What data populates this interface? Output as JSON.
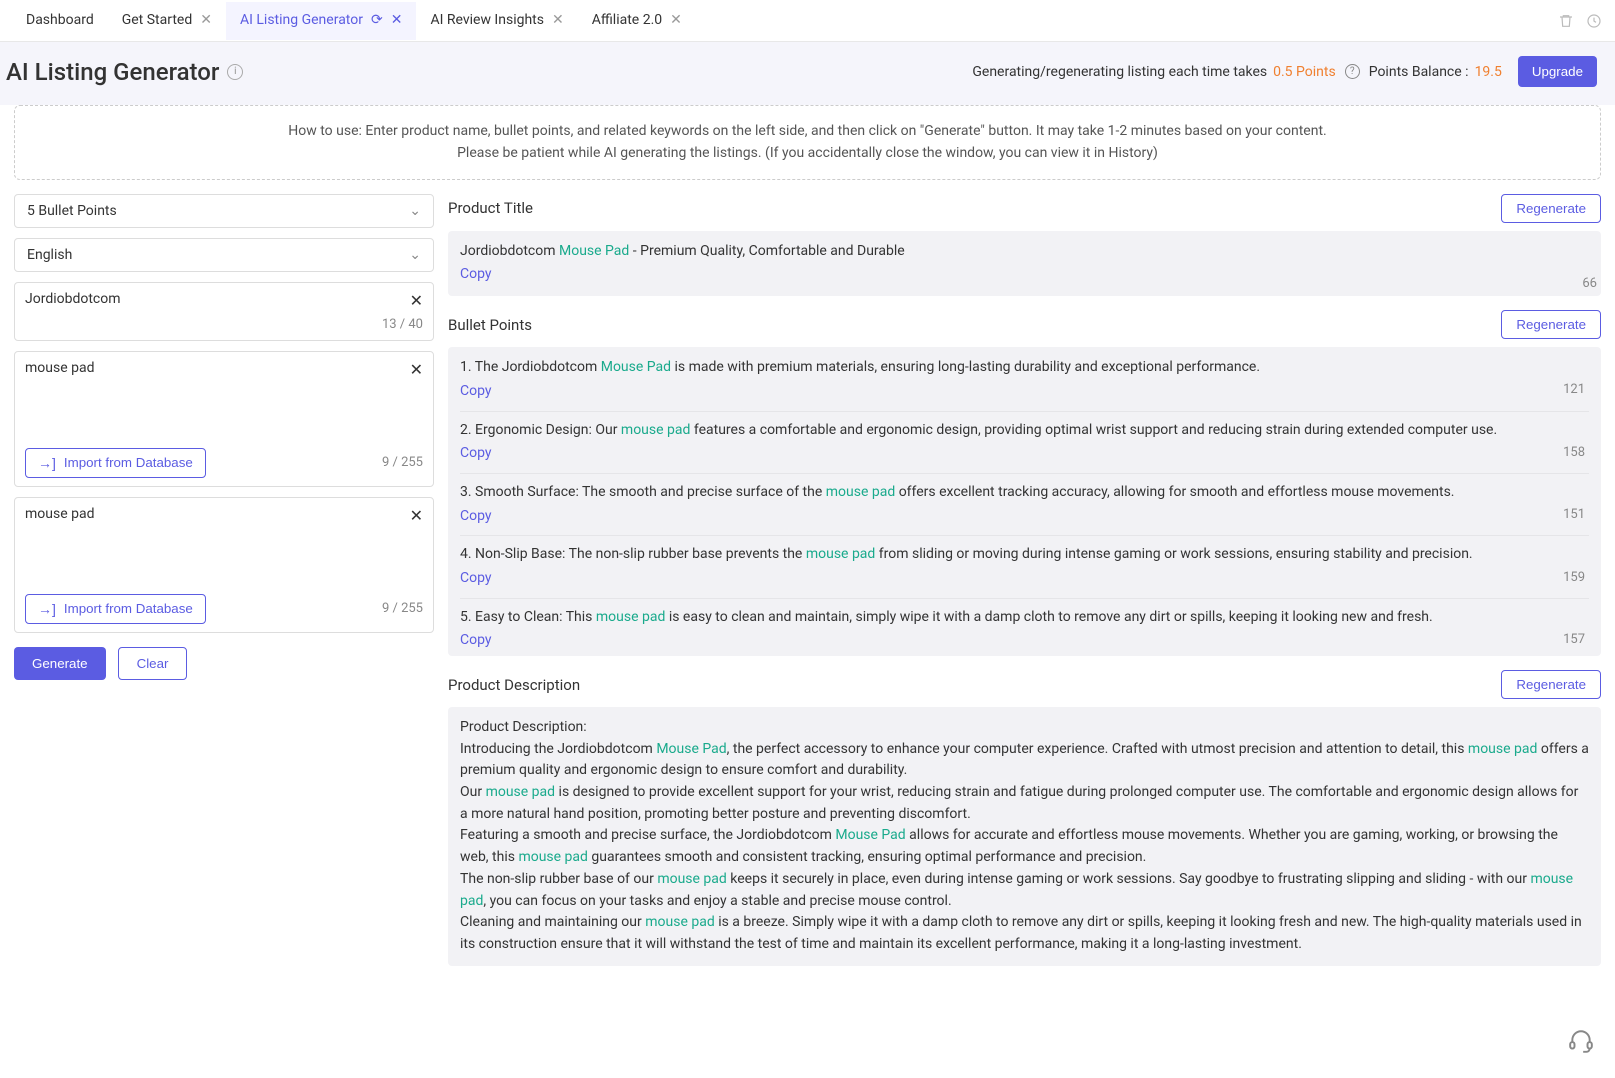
{
  "tabs": [
    {
      "label": "Dashboard",
      "closable": false
    },
    {
      "label": "Get Started",
      "closable": true
    },
    {
      "label": "AI Listing Generator",
      "closable": true,
      "active": true,
      "refresh": true
    },
    {
      "label": "AI Review Insights",
      "closable": true
    },
    {
      "label": "Affiliate 2.0",
      "closable": true
    }
  ],
  "header": {
    "title": "AI Listing Generator",
    "note_prefix": "Generating/regenerating listing each time takes ",
    "note_cost": "0.5 Points",
    "balance_label": "Points Balance : ",
    "balance_value": "19.5",
    "upgrade": "Upgrade"
  },
  "howto": {
    "line1": "How to use: Enter product name, bullet points, and related keywords on the left side, and then click on \"Generate\" button. It may take 1-2 minutes based on your content.",
    "line2": "Please be patient while AI generating the listings. (If you accidentally close the window, you can view it in History)"
  },
  "left": {
    "bulletpoints_select": "5 Bullet Points",
    "language_select": "English",
    "product_name": "Jordiobdotcom",
    "product_name_counter": "13 / 40",
    "bullets_input": "mouse pad",
    "bullets_counter": "9 / 255",
    "keywords_input": "mouse pad",
    "keywords_counter": "9 / 255",
    "import_label": "Import from Database",
    "generate": "Generate",
    "clear": "Clear"
  },
  "output": {
    "title_section": "Product Title",
    "bullets_section": "Bullet Points",
    "desc_section": "Product Description",
    "regenerate": "Regenerate",
    "copy": "Copy",
    "title_pre": "Jordiobdotcom ",
    "title_kw": "Mouse Pad",
    "title_post": " - Premium Quality, Comfortable and Durable",
    "title_count": "66",
    "bullets": [
      {
        "pre": "1. The Jordiobdotcom ",
        "kw": "Mouse Pad",
        "post": " is made with premium materials, ensuring long-lasting durability and exceptional performance.",
        "count": "121"
      },
      {
        "pre": "2. Ergonomic Design: Our ",
        "kw": "mouse pad",
        "post": " features a comfortable and ergonomic design, providing optimal wrist support and reducing strain during extended computer use.",
        "count": "158"
      },
      {
        "pre": "3. Smooth Surface: The smooth and precise surface of the ",
        "kw": "mouse pad",
        "post": " offers excellent tracking accuracy, allowing for smooth and effortless mouse movements.",
        "count": "151"
      },
      {
        "pre": "4. Non-Slip Base: The non-slip rubber base prevents the ",
        "kw": "mouse pad",
        "post": " from sliding or moving during intense gaming or work sessions, ensuring stability and precision.",
        "count": "159"
      },
      {
        "pre": "5. Easy to Clean: This ",
        "kw": "mouse pad",
        "post": " is easy to clean and maintain, simply wipe it with a damp cloth to remove any dirt or spills, keeping it looking new and fresh.",
        "count": "157"
      }
    ],
    "desc": {
      "heading": "Product Description:",
      "p1a": "Introducing the Jordiobdotcom ",
      "p1kw": "Mouse Pad",
      "p1b": ", the perfect accessory to enhance your computer experience. Crafted with utmost precision and attention to detail, this ",
      "p1kw2": "mouse pad",
      "p1c": " offers a premium quality and ergonomic design to ensure comfort and durability.",
      "p2a": "Our ",
      "p2kw": "mouse pad",
      "p2b": " is designed to provide excellent support for your wrist, reducing strain and fatigue during prolonged computer use. The comfortable and ergonomic design allows for a more natural hand position, promoting better posture and preventing discomfort.",
      "p3a": "Featuring a smooth and precise surface, the Jordiobdotcom ",
      "p3kw": "Mouse Pad",
      "p3b": " allows for accurate and effortless mouse movements. Whether you are gaming, working, or browsing the web, this ",
      "p3kw2": "mouse pad",
      "p3c": " guarantees smooth and consistent tracking, ensuring optimal performance and precision.",
      "p4a": "The non-slip rubber base of our ",
      "p4kw": "mouse pad",
      "p4b": " keeps it securely in place, even during intense gaming or work sessions. Say goodbye to frustrating slipping and sliding - with our ",
      "p4kw2": "mouse pad",
      "p4c": ", you can focus on your tasks and enjoy a stable and precise mouse control.",
      "p5a": "Cleaning and maintaining our ",
      "p5kw": "mouse pad",
      "p5b": " is a breeze. Simply wipe it with a damp cloth to remove any dirt or spills, keeping it looking fresh and new. The high-quality materials used in its construction ensure that it will withstand the test of time and maintain its excellent performance, making it a long-lasting investment."
    }
  }
}
